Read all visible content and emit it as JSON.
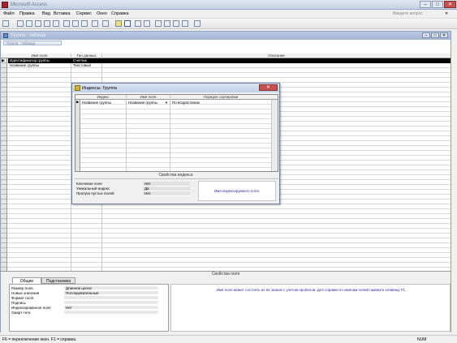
{
  "app": {
    "title": "Microsoft Access",
    "minimize": "–",
    "maximize": "□",
    "close": "✕"
  },
  "menu": {
    "items": [
      "Файл",
      "Правка",
      "Вид",
      "Вставка",
      "Сервис",
      "Окно",
      "Справка"
    ],
    "help_placeholder": "Введите вопрос"
  },
  "toolbar": {
    "icons": [
      "view-icon",
      "save-icon",
      "search-icon",
      "print-icon",
      "preview-icon",
      "spellcheck-icon",
      "cut-icon",
      "copy-icon",
      "paste-icon",
      "undo-icon",
      "redo-icon",
      "key-icon",
      "indexes-icon",
      "insert-row-icon",
      "delete-row-icon",
      "properties-icon",
      "build-icon",
      "database-window-icon",
      "new-object-icon",
      "help-icon"
    ]
  },
  "table_window": {
    "title": "Группа : таблица",
    "tab_label": "Группа : таблица",
    "columns": [
      "Имя поля",
      "Тип данных",
      "Описание"
    ],
    "rows": [
      {
        "name": "Идентификатор группы",
        "type": "Счетчик",
        "description": ""
      },
      {
        "name": "Название группы",
        "type": "Текстовый",
        "description": ""
      }
    ]
  },
  "field_properties": {
    "header": "Свойства поля",
    "tabs": [
      "Общие",
      "Подстановка"
    ],
    "props": [
      {
        "label": "Размер поля",
        "value": "Длинное целое"
      },
      {
        "label": "Новые значения",
        "value": "Последовательные"
      },
      {
        "label": "Формат поля",
        "value": ""
      },
      {
        "label": "Подпись",
        "value": ""
      },
      {
        "label": "Индексированное поле",
        "value": "Нет"
      },
      {
        "label": "Смарт-теги",
        "value": ""
      }
    ],
    "help_text": "Имя поля может состоять из 64 знаков с учетом пробелов.  Для справки по именам полей нажмите клавишу F1."
  },
  "index_dialog": {
    "title": "Индексы: Группа",
    "close": "✕",
    "columns": [
      "Индекс",
      "Имя поля",
      "Порядок сортировки"
    ],
    "rows": [
      {
        "index": "Название группы",
        "field": "Название группы",
        "order": "По возрастанию"
      }
    ],
    "props_header": "Свойства индекса",
    "props": [
      {
        "label": "Ключевое поле",
        "value": "Нет"
      },
      {
        "label": "Уникальный индекс",
        "value": "Да"
      },
      {
        "label": "Пропуск пустых полей",
        "value": "Нет"
      }
    ],
    "help_text": "Имя индексируемого поля."
  },
  "status": {
    "text": "F6 = переключение окон.  F1 = справка.",
    "num": "NUM"
  }
}
